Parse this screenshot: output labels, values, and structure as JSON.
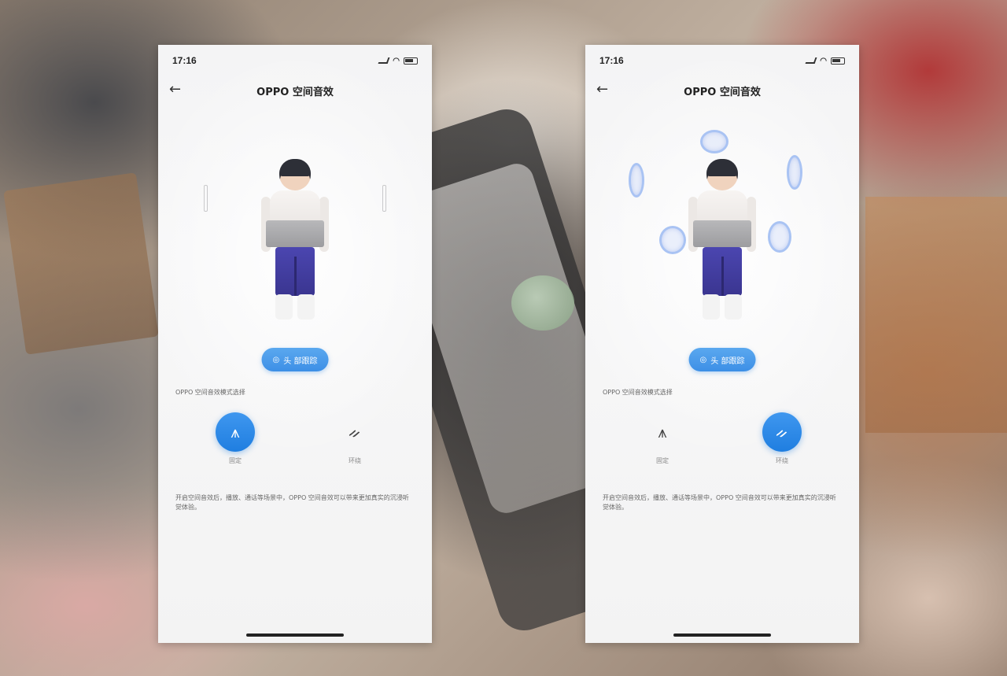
{
  "phones": [
    {
      "status_time": "17:16",
      "title": "OPPO 空间音效",
      "back_icon": "arrow-left-icon",
      "pill_label": "头 部跟踪",
      "section_label": "OPPO 空间音效模式选择",
      "modes": [
        {
          "label": "固定",
          "icon": "figure-icon",
          "active": true
        },
        {
          "label": "环绕",
          "icon": "people-icon",
          "active": false
        }
      ],
      "description": "开启空间音效后，播放、通话等场景中，OPPO 空间音效可以带来更加真实的沉浸听觉体验。"
    },
    {
      "status_time": "17:16",
      "title": "OPPO 空间音效",
      "back_icon": "arrow-left-icon",
      "pill_label": "头 部跟踪",
      "section_label": "OPPO 空间音效模式选择",
      "modes": [
        {
          "label": "固定",
          "icon": "figure-icon",
          "active": false
        },
        {
          "label": "环绕",
          "icon": "people-icon",
          "active": true
        }
      ],
      "description": "开启空间音效后，播放、通话等场景中，OPPO 空间音效可以带来更加真实的沉浸听觉体验。"
    }
  ],
  "colors": {
    "accent": "#2f86e6",
    "wave": "#a9c3f3",
    "pants": "#4b46b0"
  }
}
